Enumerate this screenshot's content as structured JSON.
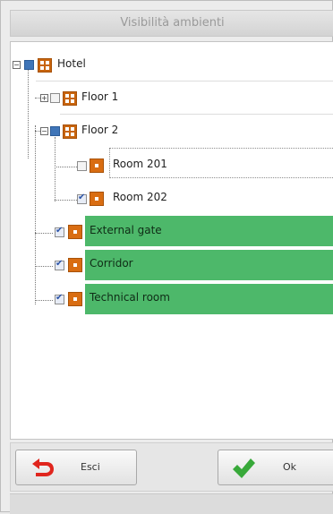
{
  "dialog": {
    "title": "Visibilità ambienti"
  },
  "tree": {
    "hotel": {
      "label": "Hotel"
    },
    "floor1": {
      "label": "Floor 1"
    },
    "floor2": {
      "label": "Floor 2"
    },
    "room201": {
      "label": "Room 201",
      "checked": false
    },
    "room202": {
      "label": "Room 202",
      "checked": true
    },
    "external_gate": {
      "label": "External gate",
      "checked": true
    },
    "corridor": {
      "label": "Corridor",
      "checked": true
    },
    "technical_room": {
      "label": "Technical room",
      "checked": true
    }
  },
  "footer": {
    "exit_label": "Esci",
    "ok_label": "Ok"
  },
  "colors": {
    "highlight": "#4db86a",
    "icon": "#d96d12",
    "exit_arrow": "#e0251d",
    "ok_check": "#38a93a"
  },
  "icons": {
    "expand": "plus-icon",
    "collapse": "minus-icon",
    "building": "building-icon",
    "room": "room-icon",
    "exit": "undo-arrow-icon",
    "ok": "checkmark-icon"
  }
}
